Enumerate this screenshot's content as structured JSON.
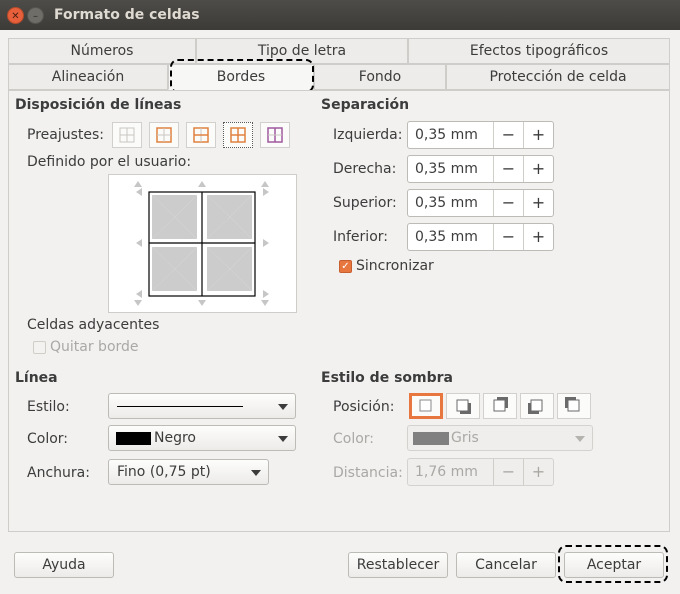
{
  "window": {
    "title": "Formato de celdas",
    "close_glyph": "✕",
    "minimize_glyph": "–"
  },
  "tabs_row1": [
    "Números",
    "Tipo de letra",
    "Efectos tipográficos"
  ],
  "tabs_row2": [
    "Alineación",
    "Bordes",
    "Fondo",
    "Protección de celda"
  ],
  "active_tab": "Bordes",
  "line_arrangement": {
    "heading": "Disposición de líneas",
    "presets_label": "Preajustes:",
    "user_defined_label": "Definido por el usuario:",
    "selected_preset_index": 3
  },
  "adjacent_cells": {
    "heading": "Celdas adyacentes",
    "remove_border_label": "Quitar borde",
    "remove_border_checked": false
  },
  "padding": {
    "heading": "Separación",
    "left_label": "Izquierda:",
    "left_value": "0,35 mm",
    "right_label": "Derecha:",
    "right_value": "0,35 mm",
    "top_label": "Superior:",
    "top_value": "0,35 mm",
    "bottom_label": "Inferior:",
    "bottom_value": "0,35 mm",
    "minus": "−",
    "plus": "+",
    "sync_label": "Sincronizar",
    "sync_checked": true,
    "check_glyph": "✓"
  },
  "line": {
    "heading": "Línea",
    "style_label": "Estilo:",
    "color_label": "Color:",
    "color_value": "Negro",
    "color_swatch": "#000000",
    "width_label": "Anchura:",
    "width_value": "Fino (0,75 pt)"
  },
  "shadow": {
    "heading": "Estilo de sombra",
    "position_label": "Posición:",
    "selected_index": 0,
    "color_label": "Color:",
    "color_value": "Gris",
    "color_swatch": "#808080",
    "distance_label": "Distancia:",
    "distance_value": "1,76 mm"
  },
  "buttons": {
    "help": "Ayuda",
    "reset": "Restablecer",
    "cancel": "Cancelar",
    "ok": "Aceptar"
  },
  "colors": {
    "accent": "#e8763f",
    "preset_line": "#e0813f"
  }
}
